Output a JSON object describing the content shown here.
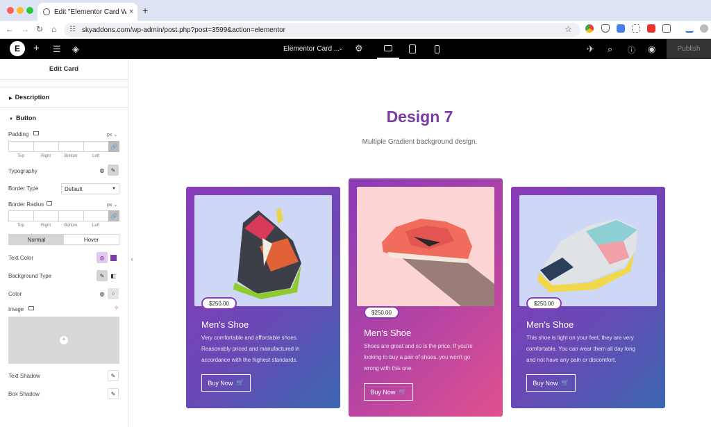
{
  "browser": {
    "tab_title": "Edit \"Elementor Card Widget\"",
    "tab_close": "×",
    "new_tab": "+",
    "url": "skyaddons.com/wp-admin/post.php?post=3599&action=elementor"
  },
  "editor": {
    "page_title": "Elementor Card ...",
    "publish_label": "Publish"
  },
  "sidebar": {
    "title": "Edit Card",
    "section_description": "Description",
    "section_button": "Button",
    "padding_label": "Padding",
    "unit_px": "px",
    "dim_top": "Top",
    "dim_right": "Right",
    "dim_bottom": "Bottom",
    "dim_left": "Left",
    "typography_label": "Typography",
    "border_type_label": "Border Type",
    "border_type_value": "Default",
    "border_radius_label": "Border Radius",
    "tab_normal": "Normal",
    "tab_hover": "Hover",
    "text_color_label": "Text Color",
    "background_type_label": "Background Type",
    "color_label": "Color",
    "image_label": "Image",
    "text_shadow_label": "Text Shadow",
    "box_shadow_label": "Box Shadow"
  },
  "canvas": {
    "heading": "Design 7",
    "subheading": "Multiple Gradient background design.",
    "cards": [
      {
        "price": "$250.00",
        "title": "Men's Shoe",
        "description": "Very comfortable and affordable shoes. Reasonably priced and manufactured in accordance with the highest standards.",
        "button": "Buy Now"
      },
      {
        "price": "$250.00",
        "title": "Men's Shoe",
        "description": "Shoes are great and so is the price. If you're looking to buy a pair of shoes, you won't go wrong with this one.",
        "button": "Buy Now"
      },
      {
        "price": "$250.00",
        "title": "Men's Shoe",
        "description": "This shoe is light on your feet, they are very comfortable. You can wear them all day long and not have any pain or discomfort.",
        "button": "Buy Now"
      }
    ]
  },
  "colors": {
    "heading": "#7b3aa3",
    "card_gradient_start": "#8a3bb8",
    "card_gradient_end": "#3b67b1",
    "featured_gradient_end": "#e0508f",
    "photo_background_1": "#ced8f6",
    "photo_background_2": "#fcd4d4",
    "text_color_swatch": "#7c3aad"
  }
}
